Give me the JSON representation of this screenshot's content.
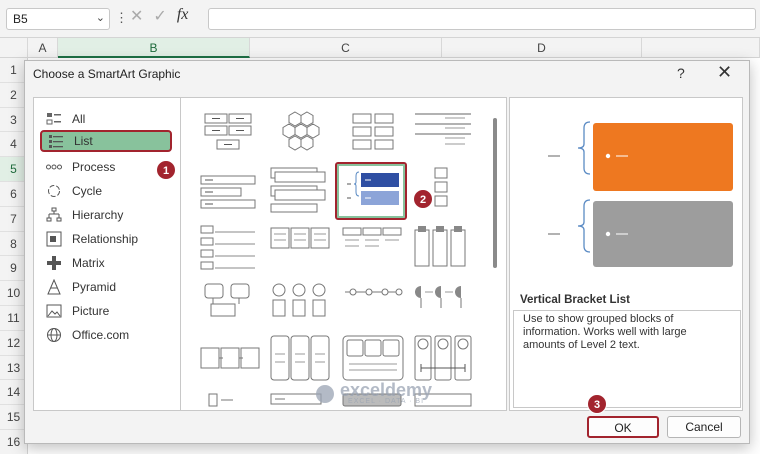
{
  "formula_bar": {
    "cell_ref": "B5",
    "fx_label": "fx"
  },
  "columns": [
    "A",
    "B",
    "C",
    "D"
  ],
  "rows": [
    "1",
    "2",
    "3",
    "4",
    "5",
    "6",
    "7",
    "8",
    "9",
    "10",
    "11",
    "12",
    "13",
    "14",
    "15",
    "16"
  ],
  "active": {
    "column": "B",
    "row": "5"
  },
  "dialog": {
    "title": "Choose a SmartArt Graphic",
    "help": "?",
    "close": "✕",
    "categories": [
      {
        "label": "All",
        "icon": "all-icon"
      },
      {
        "label": "List",
        "icon": "list-icon"
      },
      {
        "label": "Process",
        "icon": "process-icon"
      },
      {
        "label": "Cycle",
        "icon": "cycle-icon"
      },
      {
        "label": "Hierarchy",
        "icon": "hierarchy-icon"
      },
      {
        "label": "Relationship",
        "icon": "relationship-icon"
      },
      {
        "label": "Matrix",
        "icon": "matrix-icon"
      },
      {
        "label": "Pyramid",
        "icon": "pyramid-icon"
      },
      {
        "label": "Picture",
        "icon": "picture-icon"
      },
      {
        "label": "Office.com",
        "icon": "globe-icon"
      }
    ],
    "selected_category": "List",
    "preview": {
      "title": "Vertical Bracket List",
      "description": "Use to show grouped blocks of information.  Works well with large amounts of Level 2 text.",
      "colors": {
        "top": "#ee7820",
        "bottom": "#9d9d9d",
        "bracket": "#5b8bc4"
      }
    },
    "ok_label": "OK",
    "cancel_label": "Cancel"
  },
  "badges": [
    "1",
    "2",
    "3"
  ],
  "watermark": {
    "name": "exceldemy",
    "tagline": "EXCEL · DATA · BI"
  }
}
